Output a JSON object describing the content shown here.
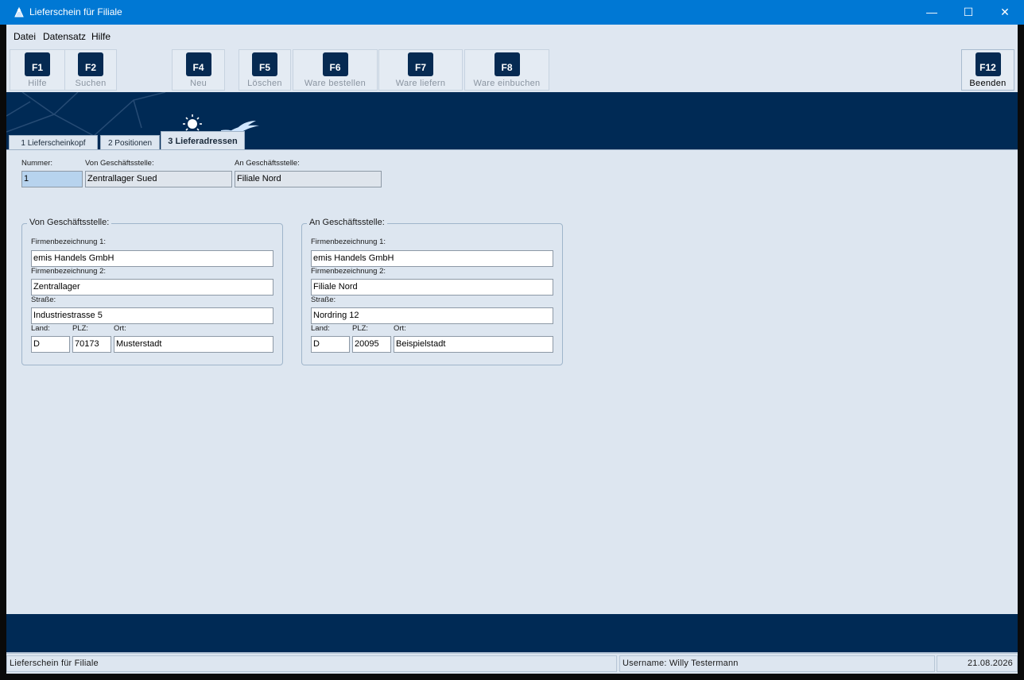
{
  "window": {
    "title": "Lieferschein für Filiale",
    "minimize": "—",
    "maximize": "☐",
    "close": "✕"
  },
  "menu": [
    "Datei",
    "Datensatz",
    "Hilfe"
  ],
  "toolbar": [
    {
      "key": "F1",
      "label": "Hilfe",
      "enabled": false
    },
    {
      "key": "F2",
      "label": "Suchen",
      "enabled": false
    },
    {
      "key": "F4",
      "label": "Neu",
      "enabled": false
    },
    {
      "key": "F5",
      "label": "Löschen",
      "enabled": false
    },
    {
      "key": "F6",
      "label": "Ware bestellen",
      "enabled": false
    },
    {
      "key": "F7",
      "label": "Ware liefern",
      "enabled": false
    },
    {
      "key": "F8",
      "label": "Ware einbuchen",
      "enabled": false
    },
    {
      "key": "F12",
      "label": "Beenden",
      "enabled": true
    }
  ],
  "tabs": [
    {
      "label": "1 Lieferscheinkopf",
      "active": false
    },
    {
      "label": "2 Positionen",
      "active": false
    },
    {
      "label": "3 Lieferadressen",
      "active": true
    }
  ],
  "header": {
    "nummer_label": "Nummer:",
    "nummer_value": "1",
    "von_label": "Von Geschäftsstelle:",
    "von_value": "Zentrallager Sued",
    "an_label": "An Geschäftsstelle:",
    "an_value": "Filiale Nord"
  },
  "von": {
    "title": "Von Geschäftsstelle:",
    "firma1_label": "Firmenbezeichnung 1:",
    "firma1": "emis Handels GmbH",
    "firma2_label": "Firmenbezeichnung 2:",
    "firma2": "Zentrallager",
    "strasse_label": "Straße:",
    "strasse": "Industriestrasse 5",
    "land_label": "Land:",
    "land": "D",
    "plz_label": "PLZ:",
    "plz": "70173",
    "ort_label": "Ort:",
    "ort": "Musterstadt"
  },
  "an": {
    "title": "An Geschäftsstelle:",
    "firma1_label": "Firmenbezeichnung 1:",
    "firma1": "emis Handels GmbH",
    "firma2_label": "Firmenbezeichnung 2:",
    "firma2": "Filiale Nord",
    "strasse_label": "Straße:",
    "strasse": "Nordring 12",
    "land_label": "Land:",
    "land": "D",
    "plz_label": "PLZ:",
    "plz": "20095",
    "ort_label": "Ort:",
    "ort": "Beispielstadt"
  },
  "status": {
    "form": "Lieferschein für Filiale",
    "user": "Username: Willy Testermann",
    "date": "21.08.2026"
  },
  "colors": {
    "titlebar": "#0078d4",
    "banner": "#002a55",
    "background": "#dde6f0"
  }
}
